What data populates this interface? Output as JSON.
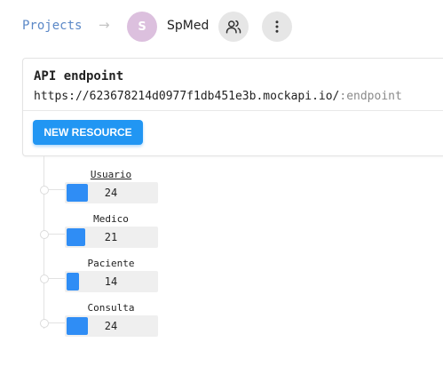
{
  "breadcrumb": {
    "projects_label": "Projects",
    "separator": "→"
  },
  "project": {
    "avatar_letter": "S",
    "name": "SpMed"
  },
  "api": {
    "title": "API endpoint",
    "base_url": "https://623678214d0977f1db451e3b.mockapi.io/",
    "suffix": ":endpoint"
  },
  "new_resource_label": "NEW RESOURCE",
  "resources": [
    {
      "name": "Usuario",
      "count": "24",
      "fill": 1.0
    },
    {
      "name": "Medico",
      "count": "21",
      "fill": 0.875
    },
    {
      "name": "Paciente",
      "count": "14",
      "fill": 0.5833
    },
    {
      "name": "Consulta",
      "count": "24",
      "fill": 1.0
    }
  ],
  "colors": {
    "accent": "#2196f3",
    "bar": "#2f8df5",
    "link": "#5b88c7",
    "avatar": "#dcc0de"
  }
}
